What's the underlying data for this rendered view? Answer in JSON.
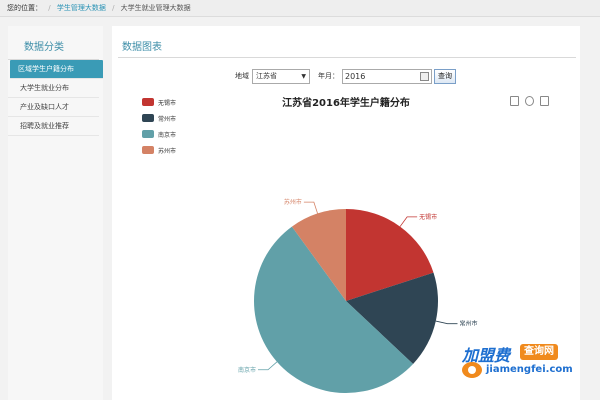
{
  "breadcrumb": {
    "label": "您的位置：",
    "link": "学生管理大数据",
    "current": "大学生就业管理大数据"
  },
  "sidebar": {
    "title": "数据分类",
    "items": [
      {
        "label": "区域学生户籍分布",
        "active": true
      },
      {
        "label": "大学生就业分布",
        "active": false
      },
      {
        "label": "产业及缺口人才",
        "active": false
      },
      {
        "label": "招聘及就业推荐",
        "active": false
      }
    ]
  },
  "main": {
    "title": "数据图表"
  },
  "filter": {
    "region_label": "地域",
    "region_value": "江苏省",
    "year_label": "年月：",
    "year_value": "2016",
    "query_button": "查询"
  },
  "chart_data": {
    "type": "pie",
    "title": "江苏省2016年学生户籍分布",
    "legend_position": "top-left",
    "slices": [
      {
        "name": "无锡市",
        "value": 20,
        "color": "#c23531"
      },
      {
        "name": "常州市",
        "value": 17,
        "color": "#2f4554"
      },
      {
        "name": "南京市",
        "value": 53,
        "color": "#61a0a8"
      },
      {
        "name": "苏州市",
        "value": 10,
        "color": "#d48265"
      }
    ]
  },
  "toolbox": [
    "data-view-icon",
    "refresh-icon",
    "download-icon"
  ],
  "watermark": {
    "brand": "加盟费",
    "tag": "查询网",
    "url": "jiamengfei.com"
  }
}
